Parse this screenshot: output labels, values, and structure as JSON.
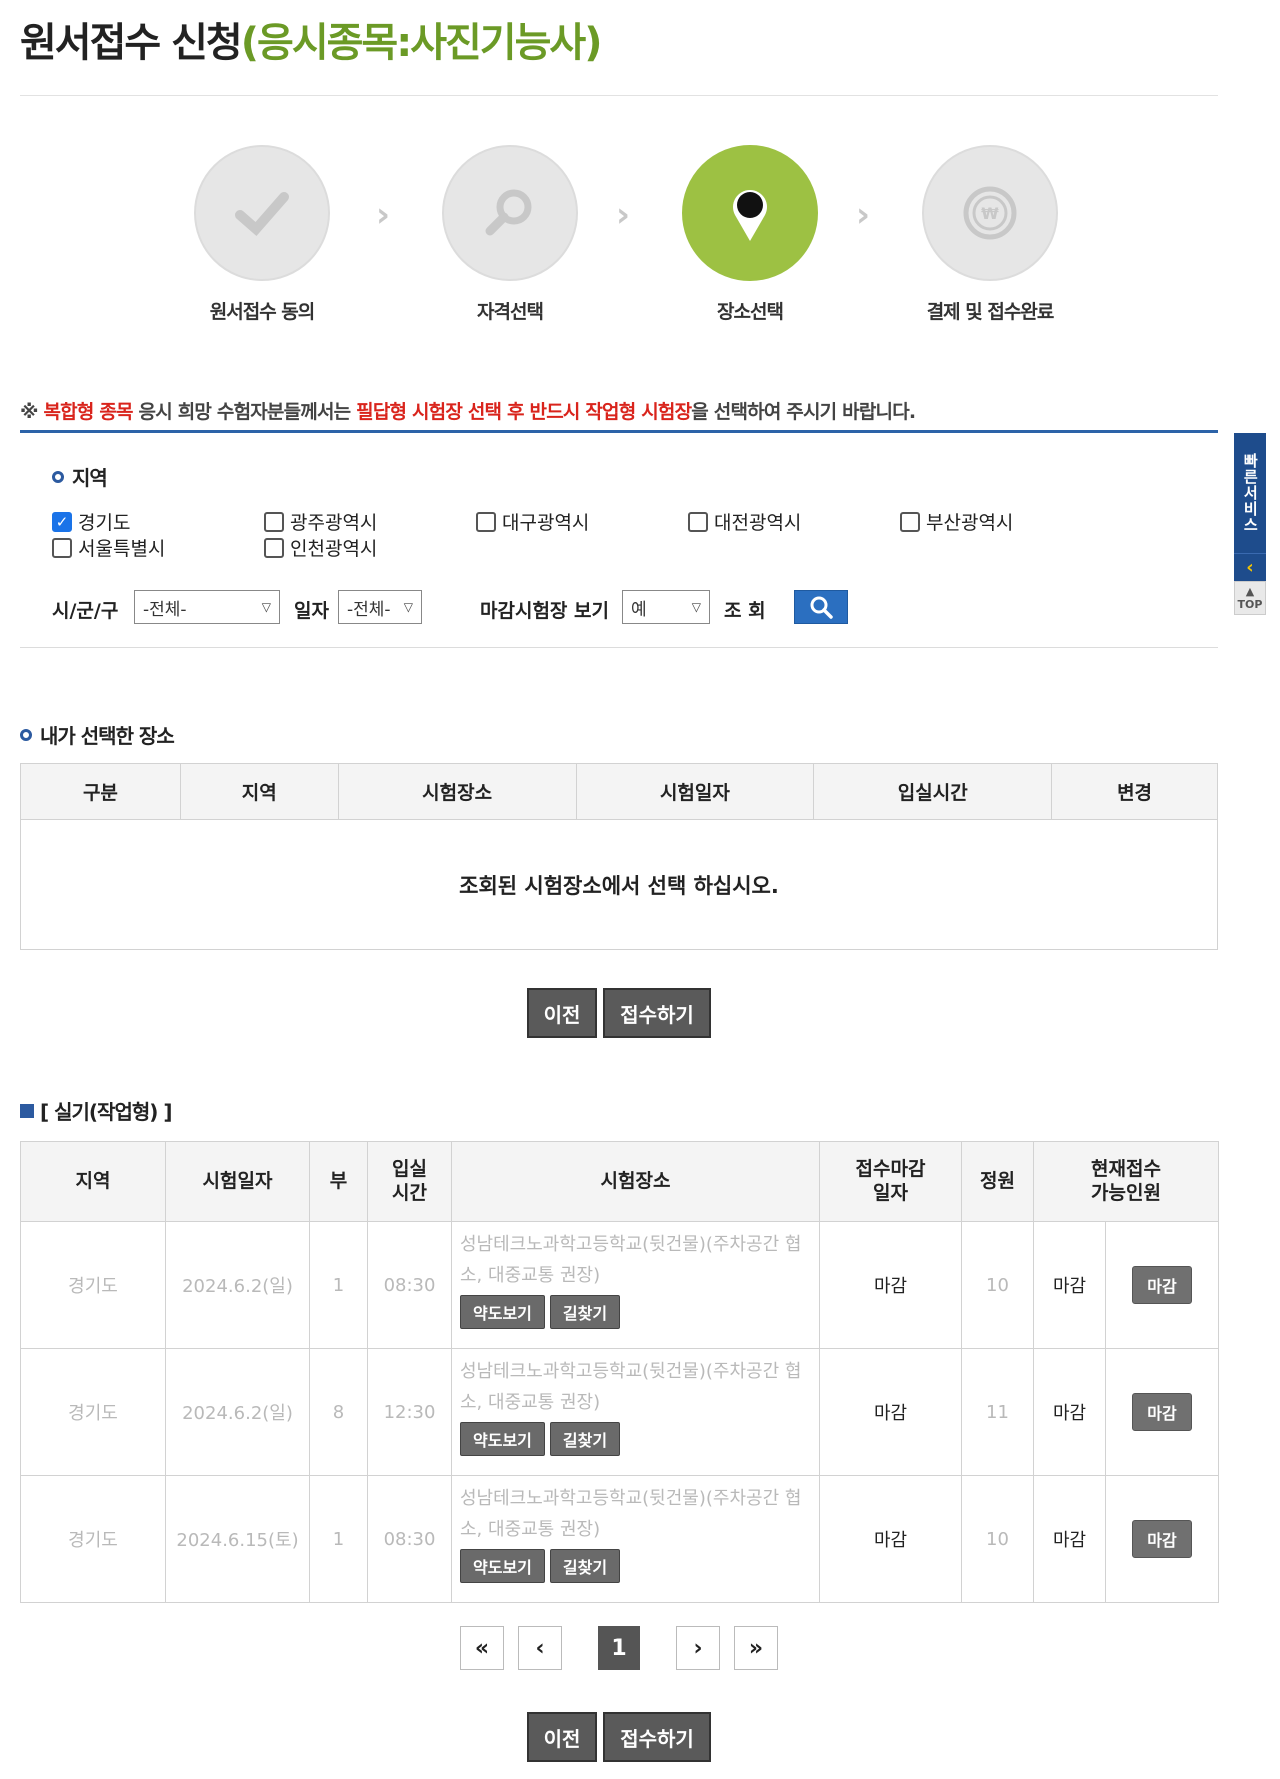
{
  "title": {
    "main": "원서접수 신청",
    "sub": "(응시종목:사진기능사)"
  },
  "steps": [
    {
      "label": "원서접수 동의",
      "icon": "check-icon",
      "active": false
    },
    {
      "label": "자격선택",
      "icon": "search-icon",
      "active": false
    },
    {
      "label": "장소선택",
      "icon": "location-pin-icon",
      "active": true
    },
    {
      "label": "결제 및 접수완료",
      "icon": "won-icon",
      "active": false
    }
  ],
  "notice": {
    "mark": "※",
    "red1": "복합형 종목",
    "t1": " 응시 희망 수험자분들께서는 ",
    "red2": "필답형 시험장 선택 후 반드시 작업형 시험장",
    "t2": "을 선택하여 주시기 바랍니다."
  },
  "region": {
    "heading": "지역",
    "options": [
      {
        "label": "경기도",
        "checked": true
      },
      {
        "label": "광주광역시",
        "checked": false
      },
      {
        "label": "대구광역시",
        "checked": false
      },
      {
        "label": "대전광역시",
        "checked": false
      },
      {
        "label": "부산광역시",
        "checked": false
      },
      {
        "label": "서울특별시",
        "checked": false
      },
      {
        "label": "인천광역시",
        "checked": false
      }
    ]
  },
  "filter": {
    "city_label": "시/군/구",
    "city_value": "-전체-",
    "date_label": "일자",
    "date_value": "-전체-",
    "closed_label": "마감시험장 보기",
    "closed_value": "예",
    "search_label": "조 회"
  },
  "selected": {
    "heading": "내가 선택한 장소",
    "columns": [
      "구분",
      "지역",
      "시험장소",
      "시험일자",
      "입실시간",
      "변경"
    ],
    "empty": "조회된 시험장소에서 선택 하십시오."
  },
  "buttons": {
    "prev": "이전",
    "submit": "접수하기"
  },
  "practical": {
    "heading": "[ 실기(작업형) ]",
    "columns": [
      "지역",
      "시험일자",
      "부",
      "입실\n시간",
      "시험장소",
      "접수마감\n일자",
      "정원",
      "현재접수\n가능인원"
    ],
    "map_btn": "약도보기",
    "route_btn": "길찾기",
    "rows": [
      {
        "region": "경기도",
        "date": "2024.6.2(일)",
        "part": "1",
        "time": "08:30",
        "place": "성남테크노과학고등학교(뒷건물)(주차공간 협소, 대중교통 권장)",
        "deadline": "마감",
        "capacity": "10",
        "available": "마감",
        "action": "마감"
      },
      {
        "region": "경기도",
        "date": "2024.6.2(일)",
        "part": "8",
        "time": "12:30",
        "place": "성남테크노과학고등학교(뒷건물)(주차공간 협소, 대중교통 권장)",
        "deadline": "마감",
        "capacity": "11",
        "available": "마감",
        "action": "마감"
      },
      {
        "region": "경기도",
        "date": "2024.6.15(토)",
        "part": "1",
        "time": "08:30",
        "place": "성남테크노과학고등학교(뒷건물)(주차공간 협소, 대중교통 권장)",
        "deadline": "마감",
        "capacity": "10",
        "available": "마감",
        "action": "마감"
      }
    ]
  },
  "pager": {
    "first": "«",
    "prev": "‹",
    "current": "1",
    "next": "›",
    "last": "»"
  },
  "quick": {
    "label": "빠른서비스",
    "top": "TOP"
  },
  "colors": {
    "accent_green": "#9dc143",
    "title_green": "#6b9a26",
    "notice_red": "#d9241c",
    "blue": "#2c63a8"
  }
}
